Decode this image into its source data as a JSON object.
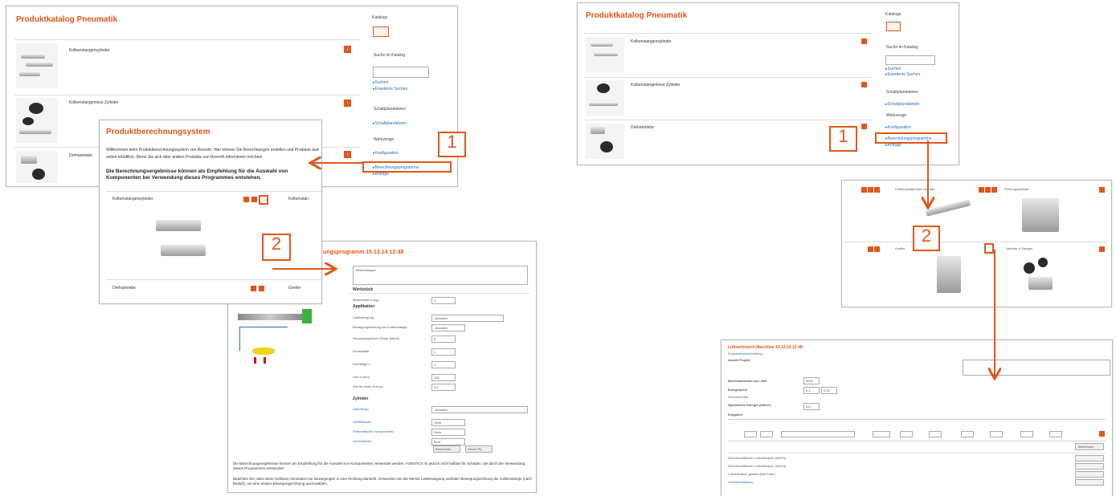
{
  "left": {
    "catalog": {
      "title": "Produktkatalog Pneumatik",
      "products": [
        "Kolbenstangenzylinder",
        "Kolbenstangenlose Zylinder",
        "Drehantriebe"
      ],
      "sidebar": {
        "heading1": "Katalogs",
        "search_heading": "Suche im Katalog",
        "links1": [
          "Suchen",
          "Erweiterte Suchen"
        ],
        "heading2": "Schaltplandateien",
        "links2": [
          "Schaltplandateien"
        ],
        "heading3": "Werkzeuge",
        "links3": [
          "Konfiguration",
          "Berechnungsprogramme",
          "Anfrage"
        ]
      }
    },
    "system": {
      "title": "Produktberechnungsystem",
      "intro": "Willkommen beim Produktberechnungssystem von Rexroth. Hier können Sie Berechnungen erstellen und Produkte auswählen.",
      "intro2": "online erhältlich. Wenn Sie sich über andere Produkte von Rexroth informieren möchten",
      "notice": "Die Berechnungsergebnisse können als Empfehlung für die Auswahl von Komponenten bei Verwendung dieses Programmes entstehen.",
      "items": [
        "Kolbenstangenzylinder",
        "Kolbenstan",
        "Drehantriebe",
        "Greifer"
      ]
    },
    "program": {
      "title": "ungsprogramm 15.13.14 12:48",
      "comment": "Bemerkungen",
      "sections": {
        "werkstueck": "Werkstück",
        "applikation": "Applikation",
        "zylinder": "Zylinder"
      },
      "fields": [
        {
          "label": "Massenlast m (kg)",
          "value": "1"
        },
        {
          "label": "Lastbewegung",
          "value": "-Auswahl-"
        },
        {
          "label": "Bewegungsrichtung der Kolbenstange",
          "value": "-Auswahl-"
        },
        {
          "label": "Versorgungsdruck P(bar) (Menü)",
          "value": "6"
        },
        {
          "label": "Druckabfall",
          "value": "1"
        },
        {
          "label": "Rohrlänge L",
          "value": "1"
        },
        {
          "label": "Hub s (mm)",
          "value": "100"
        },
        {
          "label": "Zeit für einen Hub (s)",
          "value": "0.5"
        },
        {
          "label": "Zylindertyp",
          "value": "-Auswahl-"
        },
        {
          "label": "Ventilklassen",
          "value": "Serie"
        },
        {
          "label": "Pneumatische Komponenten",
          "value": "Serie"
        },
        {
          "label": "Durchmesser",
          "value": "Best"
        }
      ],
      "buttons": [
        "Berechnen",
        "Neues Prj"
      ],
      "footer1": "Die Berechnungsergebnisse können als Empfehlung für die Auswahl von Komponenten verwendet werden. AVENTICS ist jedoch nicht haftbar für Schäden, die durch die Verwendung dieses Programmes entstanden.",
      "footer2": "Beachten Sie, dass diese Software Simulation nur Bewegungen in eine Richtung darstellt. Verwenden Sie die Menüs Lastbewegung und/oder Bewegungsrichtung der Kolbenstange (nach Bedarf), um eine andere Bewegungsrichtung auszuwählen."
    },
    "callouts": [
      "1",
      "2"
    ]
  },
  "right": {
    "catalog": {
      "title": "Produktkatalog Pneumatik",
      "products": [
        "Kolbenstangenzylinder",
        "Kolbenstangenlose Zylinder",
        "Drehantriebe"
      ],
      "sidebar": {
        "heading1": "Katalogs",
        "search_heading": "Suche im Katalog",
        "links1": [
          "Suchen",
          "Erweiterte Suchen"
        ],
        "heading2": "Schaltplandateien",
        "links2": [
          "Schaltplandateien"
        ],
        "heading3": "Werkzeuge",
        "links3": [
          "Konfiguration",
          "Berechnungsprogramme",
          "Anfrage"
        ]
      }
    },
    "grid": {
      "items": [
        "Kolbenstangenlose Zylinder",
        "Führungszylinder",
        "Greifer",
        "Vakuum & Saugen"
      ]
    },
    "calc": {
      "title": "Luftverbrauch Maschine 15.13.14 12:48",
      "subtitle": "Programmbeschreibung",
      "rows": [
        "Anzahl Projekt",
        "Betriebsstunden pro Jahr",
        "Energiepreis",
        "Schichtmodell",
        "Spezifische Energie (kW/m³)"
      ],
      "values": [
        "3000",
        "0.1",
        "0.25",
        "0.8"
      ],
      "table_label": "Eingaben",
      "result_rows": [
        "Durchschnittlicher Luftverbrauch (Nm³/h)",
        "Durchschnittlicher Luftverbrauch (Nm³/a)",
        "Luftverbrauch gesamt (Nm³/Jahr)",
        "Umweltbelastung"
      ],
      "button": "Berechnen"
    },
    "callouts": [
      "1",
      "2"
    ]
  },
  "colors": {
    "accent": "#e2561c",
    "link": "#2a6db0",
    "border": "#b9b9b9"
  }
}
